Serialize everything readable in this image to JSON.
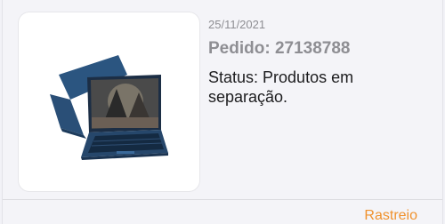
{
  "order": {
    "date": "25/11/2021",
    "order_label": "Pedido: 27138788",
    "status_text": "Status: Produtos em separação.",
    "product_image_icon": "laptop-image",
    "track_label": "Rastreio"
  },
  "colors": {
    "track_accent": "#f0922e",
    "muted_text": "#8e8e93"
  }
}
